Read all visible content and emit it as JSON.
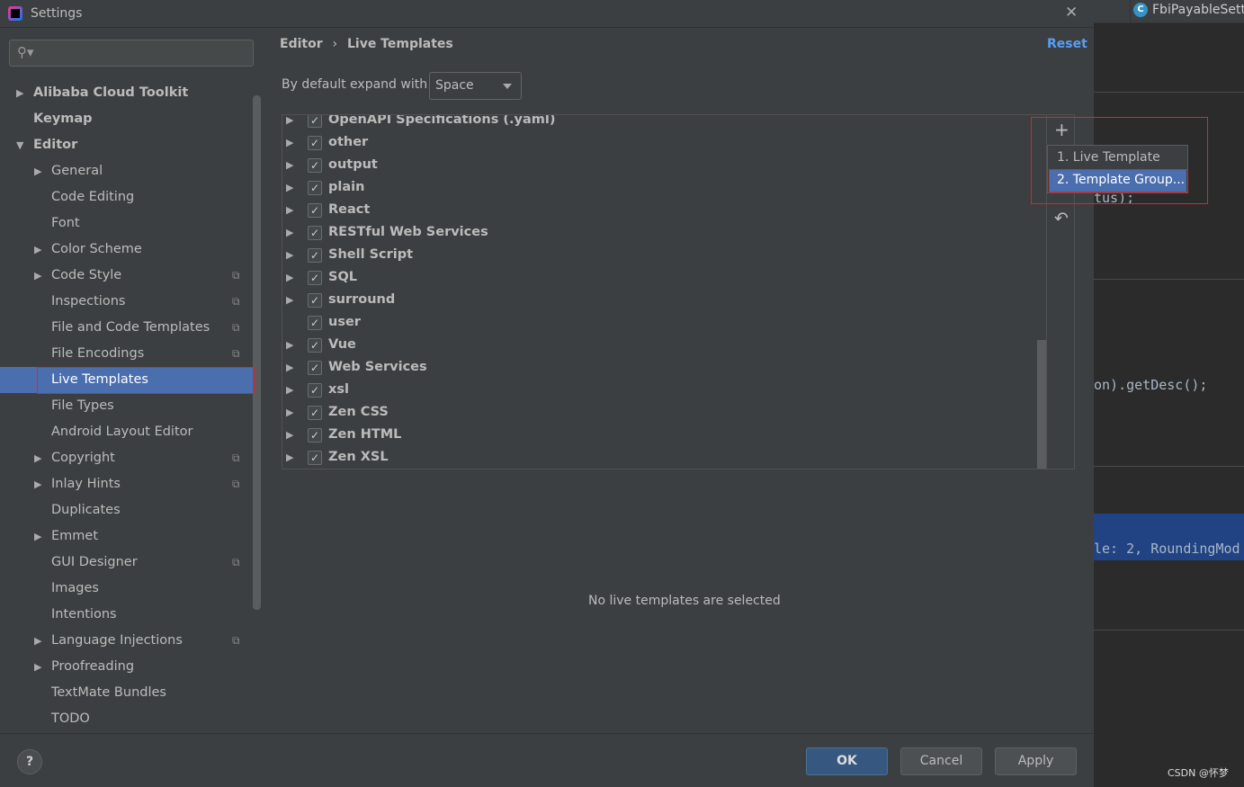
{
  "window": {
    "title": "Settings"
  },
  "search": {
    "placeholder": ""
  },
  "sidebar": {
    "items": [
      {
        "label": "Alibaba Cloud Toolkit",
        "level": 0,
        "arrow": "right",
        "bold": true
      },
      {
        "label": "Keymap",
        "level": 0,
        "bold": true
      },
      {
        "label": "Editor",
        "level": 0,
        "arrow": "down",
        "bold": true
      },
      {
        "label": "General",
        "level": 1,
        "arrow": "right"
      },
      {
        "label": "Code Editing",
        "level": 1
      },
      {
        "label": "Font",
        "level": 1
      },
      {
        "label": "Color Scheme",
        "level": 1,
        "arrow": "right"
      },
      {
        "label": "Code Style",
        "level": 1,
        "arrow": "right",
        "copy": true
      },
      {
        "label": "Inspections",
        "level": 1,
        "copy": true
      },
      {
        "label": "File and Code Templates",
        "level": 1,
        "copy": true
      },
      {
        "label": "File Encodings",
        "level": 1,
        "copy": true
      },
      {
        "label": "Live Templates",
        "level": 1,
        "selected": true
      },
      {
        "label": "File Types",
        "level": 1
      },
      {
        "label": "Android Layout Editor",
        "level": 1
      },
      {
        "label": "Copyright",
        "level": 1,
        "arrow": "right",
        "copy": true
      },
      {
        "label": "Inlay Hints",
        "level": 1,
        "arrow": "right",
        "copy": true
      },
      {
        "label": "Duplicates",
        "level": 1
      },
      {
        "label": "Emmet",
        "level": 1,
        "arrow": "right"
      },
      {
        "label": "GUI Designer",
        "level": 1,
        "copy": true
      },
      {
        "label": "Images",
        "level": 1
      },
      {
        "label": "Intentions",
        "level": 1
      },
      {
        "label": "Language Injections",
        "level": 1,
        "arrow": "right",
        "copy": true
      },
      {
        "label": "Proofreading",
        "level": 1,
        "arrow": "right"
      },
      {
        "label": "TextMate Bundles",
        "level": 1
      },
      {
        "label": "TODO",
        "level": 1
      }
    ]
  },
  "breadcrumb": {
    "parent": "Editor",
    "separator": "›",
    "current": "Live Templates"
  },
  "reset_label": "Reset",
  "expand": {
    "label": "By default expand with",
    "value": "Space"
  },
  "template_groups": [
    {
      "label": "OpenAPI Specifications (.yaml)",
      "checked": true,
      "expandable": true
    },
    {
      "label": "other",
      "checked": true,
      "expandable": true
    },
    {
      "label": "output",
      "checked": true,
      "expandable": true
    },
    {
      "label": "plain",
      "checked": true,
      "expandable": true
    },
    {
      "label": "React",
      "checked": true,
      "expandable": true
    },
    {
      "label": "RESTful Web Services",
      "checked": true,
      "expandable": true
    },
    {
      "label": "Shell Script",
      "checked": true,
      "expandable": true
    },
    {
      "label": "SQL",
      "checked": true,
      "expandable": true
    },
    {
      "label": "surround",
      "checked": true,
      "expandable": true
    },
    {
      "label": "user",
      "checked": true,
      "expandable": false
    },
    {
      "label": "Vue",
      "checked": true,
      "expandable": true
    },
    {
      "label": "Web Services",
      "checked": true,
      "expandable": true
    },
    {
      "label": "xsl",
      "checked": true,
      "expandable": true
    },
    {
      "label": "Zen CSS",
      "checked": true,
      "expandable": true
    },
    {
      "label": "Zen HTML",
      "checked": true,
      "expandable": true
    },
    {
      "label": "Zen XSL",
      "checked": true,
      "expandable": true
    }
  ],
  "add_menu": {
    "items": [
      {
        "label": "1. Live Template"
      },
      {
        "label": "2. Template Group...",
        "selected": true
      }
    ]
  },
  "empty_text": "No live templates are selected",
  "buttons": {
    "ok": "OK",
    "cancel": "Cancel",
    "apply": "Apply",
    "help": "?"
  },
  "editor": {
    "tab": "FbiPayableSettl",
    "tab_icon": "C",
    "lines": [
      "tus);",
      "on).getDesc();",
      "le: 2, RoundingMod"
    ],
    "watermark": "CSDN @怀梦"
  },
  "colors": {
    "accent": "#4b6eaf",
    "link": "#589df6",
    "highlight": "#e8202a"
  }
}
